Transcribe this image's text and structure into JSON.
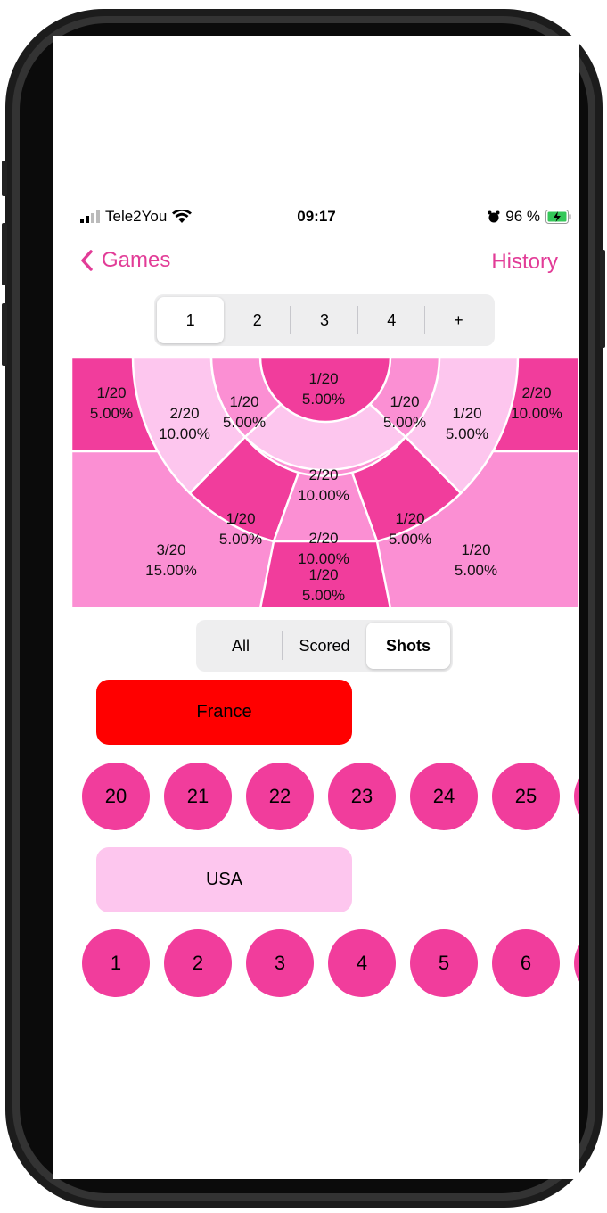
{
  "status_bar": {
    "carrier": "Tele2You",
    "time": "09:17",
    "battery": "96 %"
  },
  "nav": {
    "back_label": "Games",
    "history_label": "History"
  },
  "game_tabs": [
    "1",
    "2",
    "3",
    "4",
    "+"
  ],
  "goal_zones": {
    "top_left": {
      "fraction": "1/20",
      "percent": "5.00%"
    },
    "top_right": {
      "fraction": "2/20",
      "percent": "10.00%"
    },
    "bottom_left": {
      "fraction": "3/20",
      "percent": "15.00%"
    },
    "bottom_right": {
      "fraction": "1/20",
      "percent": "5.00%"
    },
    "bottom_center": {
      "fraction": "1/20",
      "percent": "5.00%"
    },
    "outer_left": {
      "fraction": "2/20",
      "percent": "10.00%"
    },
    "outer_right": {
      "fraction": "1/20",
      "percent": "5.00%"
    },
    "middle_top_left": {
      "fraction": "1/20",
      "percent": "5.00%"
    },
    "middle_top_right": {
      "fraction": "1/20",
      "percent": "5.00%"
    },
    "middle_bottom_left": {
      "fraction": "1/20",
      "percent": "5.00%"
    },
    "middle_bottom_right": {
      "fraction": "1/20",
      "percent": "5.00%"
    },
    "middle_bottom_center": {
      "fraction": "2/20",
      "percent": "10.00%"
    },
    "inner_top": {
      "fraction": "1/20",
      "percent": "5.00%"
    },
    "inner_bottom": {
      "fraction": "2/20",
      "percent": "10.00%"
    }
  },
  "filter_tabs": [
    "All",
    "Scored",
    "Shots"
  ],
  "teams": [
    {
      "name": "France",
      "color": "#ff0000",
      "players": [
        "20",
        "21",
        "22",
        "23",
        "24",
        "25"
      ]
    },
    {
      "name": "USA",
      "color": "#fdc6ee",
      "players": [
        "1",
        "2",
        "3",
        "4",
        "5",
        "6"
      ]
    }
  ],
  "colors": {
    "accent": "#e23c97",
    "dark_pink": "#f13d9c",
    "mid_pink": "#fb8fd3",
    "light_pink": "#fdc6ee"
  }
}
